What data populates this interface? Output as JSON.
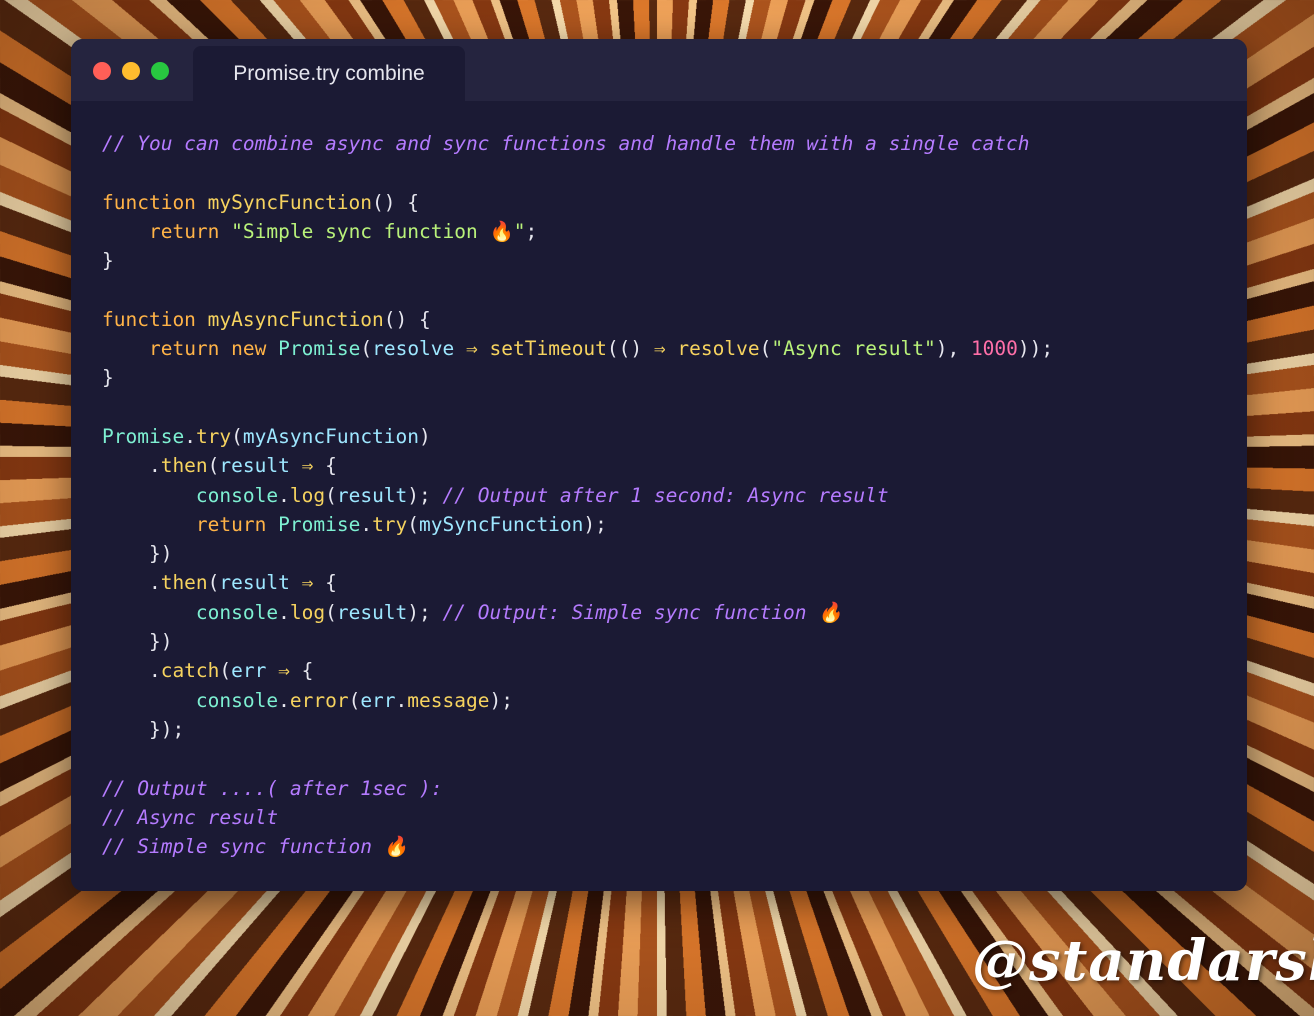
{
  "window": {
    "tab_title": "Promise.try combine"
  },
  "colors": {
    "close": "#ff5f57",
    "minimize": "#febc2e",
    "maximize": "#28c840",
    "editor_bg": "#1b1a34",
    "comment": "#b57bff",
    "keyword": "#ffb347",
    "function": "#f6d35f",
    "string": "#b9f27a",
    "class": "#7ef0d2",
    "number": "#ff6fa8"
  },
  "code": {
    "lines": [
      [
        {
          "t": "// You can combine async and sync functions and handle them with a single catch",
          "k": "comment"
        }
      ],
      [],
      [
        {
          "t": "function",
          "k": "kw"
        },
        {
          "t": " ",
          "k": "punct"
        },
        {
          "t": "mySyncFunction",
          "k": "fn"
        },
        {
          "t": "() {",
          "k": "punct"
        }
      ],
      [
        {
          "t": "    ",
          "k": "punct"
        },
        {
          "t": "return",
          "k": "kw"
        },
        {
          "t": " ",
          "k": "punct"
        },
        {
          "t": "\"Simple sync function 🔥\"",
          "k": "str"
        },
        {
          "t": ";",
          "k": "punct"
        }
      ],
      [
        {
          "t": "}",
          "k": "punct"
        }
      ],
      [],
      [
        {
          "t": "function",
          "k": "kw"
        },
        {
          "t": " ",
          "k": "punct"
        },
        {
          "t": "myAsyncFunction",
          "k": "fn"
        },
        {
          "t": "() {",
          "k": "punct"
        }
      ],
      [
        {
          "t": "    ",
          "k": "punct"
        },
        {
          "t": "return",
          "k": "kw"
        },
        {
          "t": " ",
          "k": "punct"
        },
        {
          "t": "new",
          "k": "kw"
        },
        {
          "t": " ",
          "k": "punct"
        },
        {
          "t": "Promise",
          "k": "cls"
        },
        {
          "t": "(",
          "k": "punct"
        },
        {
          "t": "resolve",
          "k": "param"
        },
        {
          "t": " ⇒ ",
          "k": "arrow"
        },
        {
          "t": "setTimeout",
          "k": "fn"
        },
        {
          "t": "(() ",
          "k": "punct"
        },
        {
          "t": "⇒",
          "k": "arrow"
        },
        {
          "t": " ",
          "k": "punct"
        },
        {
          "t": "resolve",
          "k": "fn"
        },
        {
          "t": "(",
          "k": "punct"
        },
        {
          "t": "\"Async result\"",
          "k": "str"
        },
        {
          "t": "), ",
          "k": "punct"
        },
        {
          "t": "1000",
          "k": "num"
        },
        {
          "t": "));",
          "k": "punct"
        }
      ],
      [
        {
          "t": "}",
          "k": "punct"
        }
      ],
      [],
      [
        {
          "t": "Promise",
          "k": "cls"
        },
        {
          "t": ".",
          "k": "punct"
        },
        {
          "t": "try",
          "k": "fn"
        },
        {
          "t": "(",
          "k": "punct"
        },
        {
          "t": "myAsyncFunction",
          "k": "param"
        },
        {
          "t": ")",
          "k": "punct"
        }
      ],
      [
        {
          "t": "    .",
          "k": "punct"
        },
        {
          "t": "then",
          "k": "fn"
        },
        {
          "t": "(",
          "k": "punct"
        },
        {
          "t": "result",
          "k": "param"
        },
        {
          "t": " ⇒ ",
          "k": "arrow"
        },
        {
          "t": "{",
          "k": "punct"
        }
      ],
      [
        {
          "t": "        ",
          "k": "punct"
        },
        {
          "t": "console",
          "k": "cls"
        },
        {
          "t": ".",
          "k": "punct"
        },
        {
          "t": "log",
          "k": "fn"
        },
        {
          "t": "(",
          "k": "punct"
        },
        {
          "t": "result",
          "k": "param"
        },
        {
          "t": "); ",
          "k": "punct"
        },
        {
          "t": "// Output after 1 second: Async result",
          "k": "comment"
        }
      ],
      [
        {
          "t": "        ",
          "k": "punct"
        },
        {
          "t": "return",
          "k": "kw"
        },
        {
          "t": " ",
          "k": "punct"
        },
        {
          "t": "Promise",
          "k": "cls"
        },
        {
          "t": ".",
          "k": "punct"
        },
        {
          "t": "try",
          "k": "fn"
        },
        {
          "t": "(",
          "k": "punct"
        },
        {
          "t": "mySyncFunction",
          "k": "param"
        },
        {
          "t": ");",
          "k": "punct"
        }
      ],
      [
        {
          "t": "    })",
          "k": "punct"
        }
      ],
      [
        {
          "t": "    .",
          "k": "punct"
        },
        {
          "t": "then",
          "k": "fn"
        },
        {
          "t": "(",
          "k": "punct"
        },
        {
          "t": "result",
          "k": "param"
        },
        {
          "t": " ⇒ ",
          "k": "arrow"
        },
        {
          "t": "{",
          "k": "punct"
        }
      ],
      [
        {
          "t": "        ",
          "k": "punct"
        },
        {
          "t": "console",
          "k": "cls"
        },
        {
          "t": ".",
          "k": "punct"
        },
        {
          "t": "log",
          "k": "fn"
        },
        {
          "t": "(",
          "k": "punct"
        },
        {
          "t": "result",
          "k": "param"
        },
        {
          "t": "); ",
          "k": "punct"
        },
        {
          "t": "// Output: Simple sync function 🔥",
          "k": "comment"
        }
      ],
      [
        {
          "t": "    })",
          "k": "punct"
        }
      ],
      [
        {
          "t": "    .",
          "k": "punct"
        },
        {
          "t": "catch",
          "k": "fn"
        },
        {
          "t": "(",
          "k": "punct"
        },
        {
          "t": "err",
          "k": "param"
        },
        {
          "t": " ⇒ ",
          "k": "arrow"
        },
        {
          "t": "{",
          "k": "punct"
        }
      ],
      [
        {
          "t": "        ",
          "k": "punct"
        },
        {
          "t": "console",
          "k": "cls"
        },
        {
          "t": ".",
          "k": "punct"
        },
        {
          "t": "error",
          "k": "fn"
        },
        {
          "t": "(",
          "k": "punct"
        },
        {
          "t": "err",
          "k": "param"
        },
        {
          "t": ".",
          "k": "punct"
        },
        {
          "t": "message",
          "k": "fn"
        },
        {
          "t": ");",
          "k": "punct"
        }
      ],
      [
        {
          "t": "    });",
          "k": "punct"
        }
      ],
      [],
      [
        {
          "t": "// Output ....( after 1sec ):",
          "k": "comment"
        }
      ],
      [
        {
          "t": "// Async result",
          "k": "comment"
        }
      ],
      [
        {
          "t": "// Simple sync function 🔥",
          "k": "comment"
        }
      ]
    ]
  },
  "watermark": {
    "text": "@standarski"
  }
}
